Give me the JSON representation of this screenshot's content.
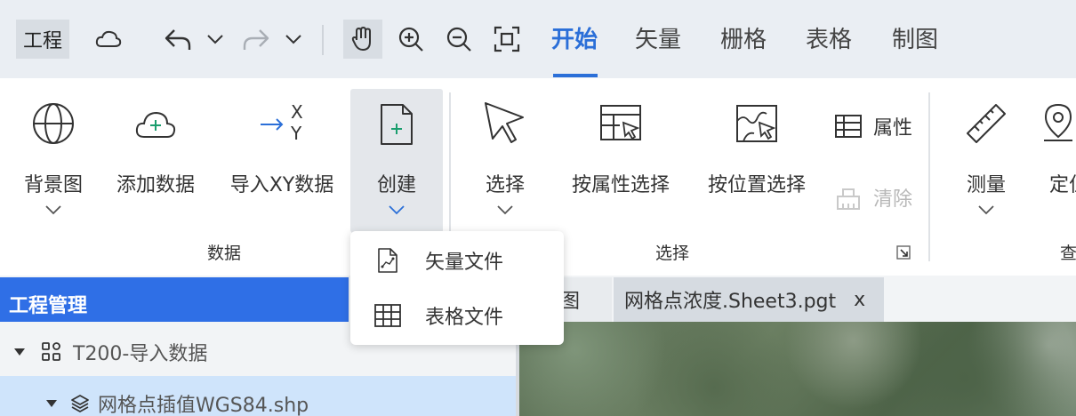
{
  "quick_access": {
    "project_label": "工程"
  },
  "tabs": [
    {
      "label": "开始",
      "active": true
    },
    {
      "label": "矢量",
      "active": false
    },
    {
      "label": "栅格",
      "active": false
    },
    {
      "label": "表格",
      "active": false
    },
    {
      "label": "制图",
      "active": false
    }
  ],
  "ribbon": {
    "data_group": {
      "label": "数据",
      "background_map": "背景图",
      "add_data": "添加数据",
      "import_xy": "导入XY数据",
      "import_xy_icon_top": "X",
      "import_xy_icon_bottom": "Y",
      "create": "创建"
    },
    "select_group": {
      "label": "选择",
      "select": "选择",
      "select_by_attribute": "按属性选择",
      "select_by_location": "按位置选择",
      "attributes": "属性",
      "clear": "清除"
    },
    "query_group": {
      "label_partial": "查",
      "measure": "测量",
      "locate_partial": "定位"
    }
  },
  "create_menu": {
    "items": [
      {
        "label": "矢量文件",
        "icon": "vector-file-icon"
      },
      {
        "label": "表格文件",
        "icon": "table-file-icon"
      }
    ]
  },
  "project_panel": {
    "title": "工程管理",
    "tree": [
      {
        "label": "T200-导入数据",
        "level": 0
      },
      {
        "label": "网格点插值WGS84.shp",
        "level": 1,
        "selected": true
      }
    ]
  },
  "document_tabs": [
    {
      "label": "图",
      "active": false
    },
    {
      "label": "网格点浓度.Sheet3.pgt",
      "active": true,
      "close": "x"
    }
  ],
  "colors": {
    "accent": "#2b6fd8",
    "panel_header": "#2f6fe6",
    "selection": "#cfe4fb",
    "toolbar_bg": "#eaeef3"
  }
}
